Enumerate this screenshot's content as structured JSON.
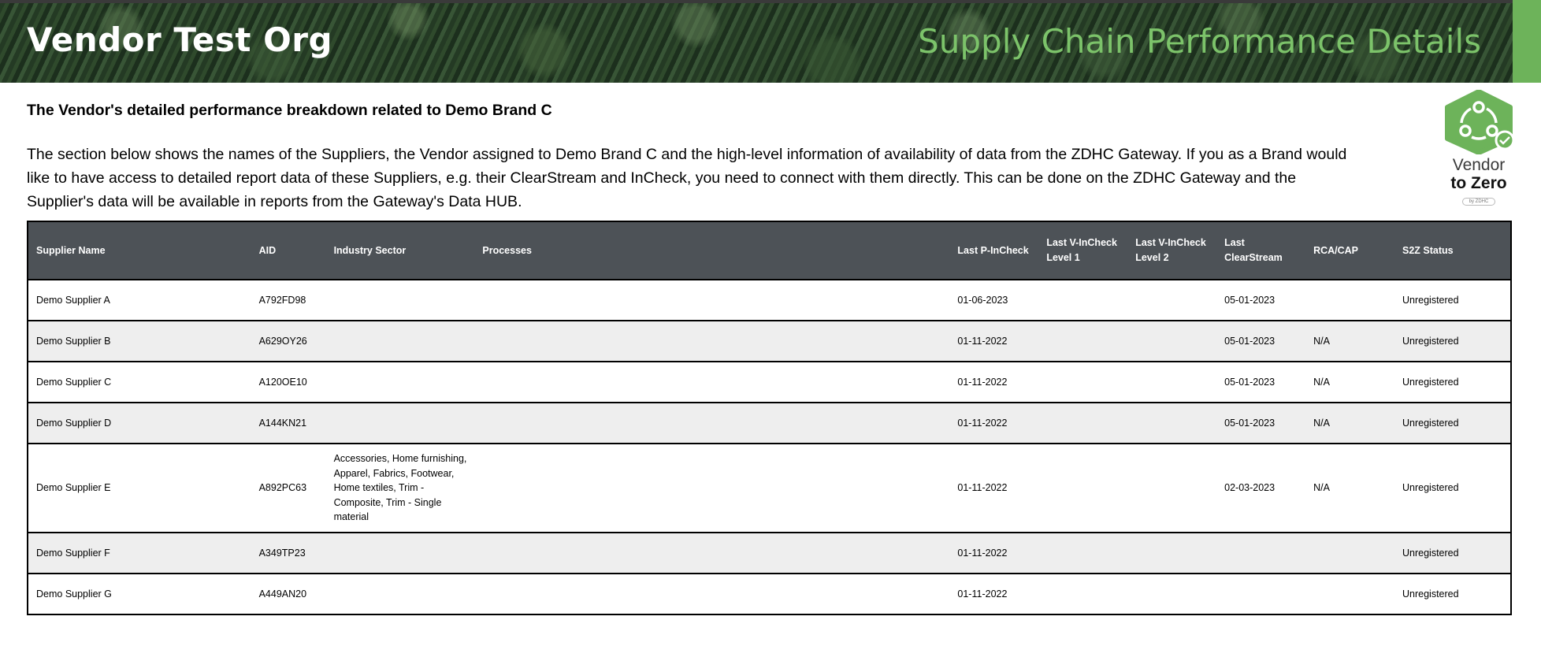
{
  "header": {
    "org_name": "Vendor Test Org",
    "page_title": "Supply Chain Performance Details"
  },
  "section": {
    "heading": "The Vendor's detailed performance breakdown related to Demo Brand C",
    "description": "The section below shows the names of the Suppliers, the Vendor assigned to Demo Brand C and the high-level information of availability of data from the ZDHC Gateway. If you as a Brand would like to have access to detailed report data of these Suppliers, e.g. their ClearStream and InCheck, you need to connect with them directly. This can be done on the ZDHC Gateway and the Supplier's data will be available in reports from the Gateway's Data HUB."
  },
  "logo": {
    "line1": "Vendor",
    "line2": "to Zero",
    "pill": "by ZDHC",
    "colors": {
      "hex": "#6db35a",
      "check": "#6db35a"
    }
  },
  "colors": {
    "banner_accent": "#6db35a",
    "title_green": "#7cc36a",
    "table_header": "#4d5257",
    "row_alt": "#eeeeee"
  },
  "table": {
    "columns": [
      "Supplier Name",
      "AID",
      "Industry Sector",
      "Processes",
      "Last P-InCheck",
      "Last V-InCheck Level 1",
      "Last V-InCheck Level 2",
      "Last ClearStream",
      "RCA/CAP",
      "S2Z Status"
    ],
    "rows": [
      {
        "name": "Demo Supplier A",
        "aid": "A792FD98",
        "sector": "",
        "processes": "",
        "p_incheck": "01-06-2023",
        "v_incheck_l1": "",
        "v_incheck_l2": "",
        "clearstream": "05-01-2023",
        "rca_cap": "",
        "s2z": "Unregistered"
      },
      {
        "name": "Demo Supplier B",
        "aid": "A629OY26",
        "sector": "",
        "processes": "",
        "p_incheck": "01-11-2022",
        "v_incheck_l1": "",
        "v_incheck_l2": "",
        "clearstream": "05-01-2023",
        "rca_cap": "N/A",
        "s2z": "Unregistered"
      },
      {
        "name": "Demo Supplier C",
        "aid": "A120OE10",
        "sector": "",
        "processes": "",
        "p_incheck": "01-11-2022",
        "v_incheck_l1": "",
        "v_incheck_l2": "",
        "clearstream": "05-01-2023",
        "rca_cap": "N/A",
        "s2z": "Unregistered"
      },
      {
        "name": "Demo Supplier D",
        "aid": "A144KN21",
        "sector": "",
        "processes": "",
        "p_incheck": "01-11-2022",
        "v_incheck_l1": "",
        "v_incheck_l2": "",
        "clearstream": "05-01-2023",
        "rca_cap": "N/A",
        "s2z": "Unregistered"
      },
      {
        "name": "Demo Supplier E",
        "aid": "A892PC63",
        "sector": "Accessories, Home furnishing, Apparel, Fabrics, Footwear, Home textiles, Trim - Composite, Trim - Single material",
        "processes": "",
        "p_incheck": "01-11-2022",
        "v_incheck_l1": "",
        "v_incheck_l2": "",
        "clearstream": "02-03-2023",
        "rca_cap": "N/A",
        "s2z": "Unregistered"
      },
      {
        "name": "Demo Supplier F",
        "aid": "A349TP23",
        "sector": "",
        "processes": "",
        "p_incheck": "01-11-2022",
        "v_incheck_l1": "",
        "v_incheck_l2": "",
        "clearstream": "",
        "rca_cap": "",
        "s2z": "Unregistered"
      },
      {
        "name": "Demo Supplier G",
        "aid": "A449AN20",
        "sector": "",
        "processes": "",
        "p_incheck": "01-11-2022",
        "v_incheck_l1": "",
        "v_incheck_l2": "",
        "clearstream": "",
        "rca_cap": "",
        "s2z": "Unregistered"
      }
    ]
  }
}
